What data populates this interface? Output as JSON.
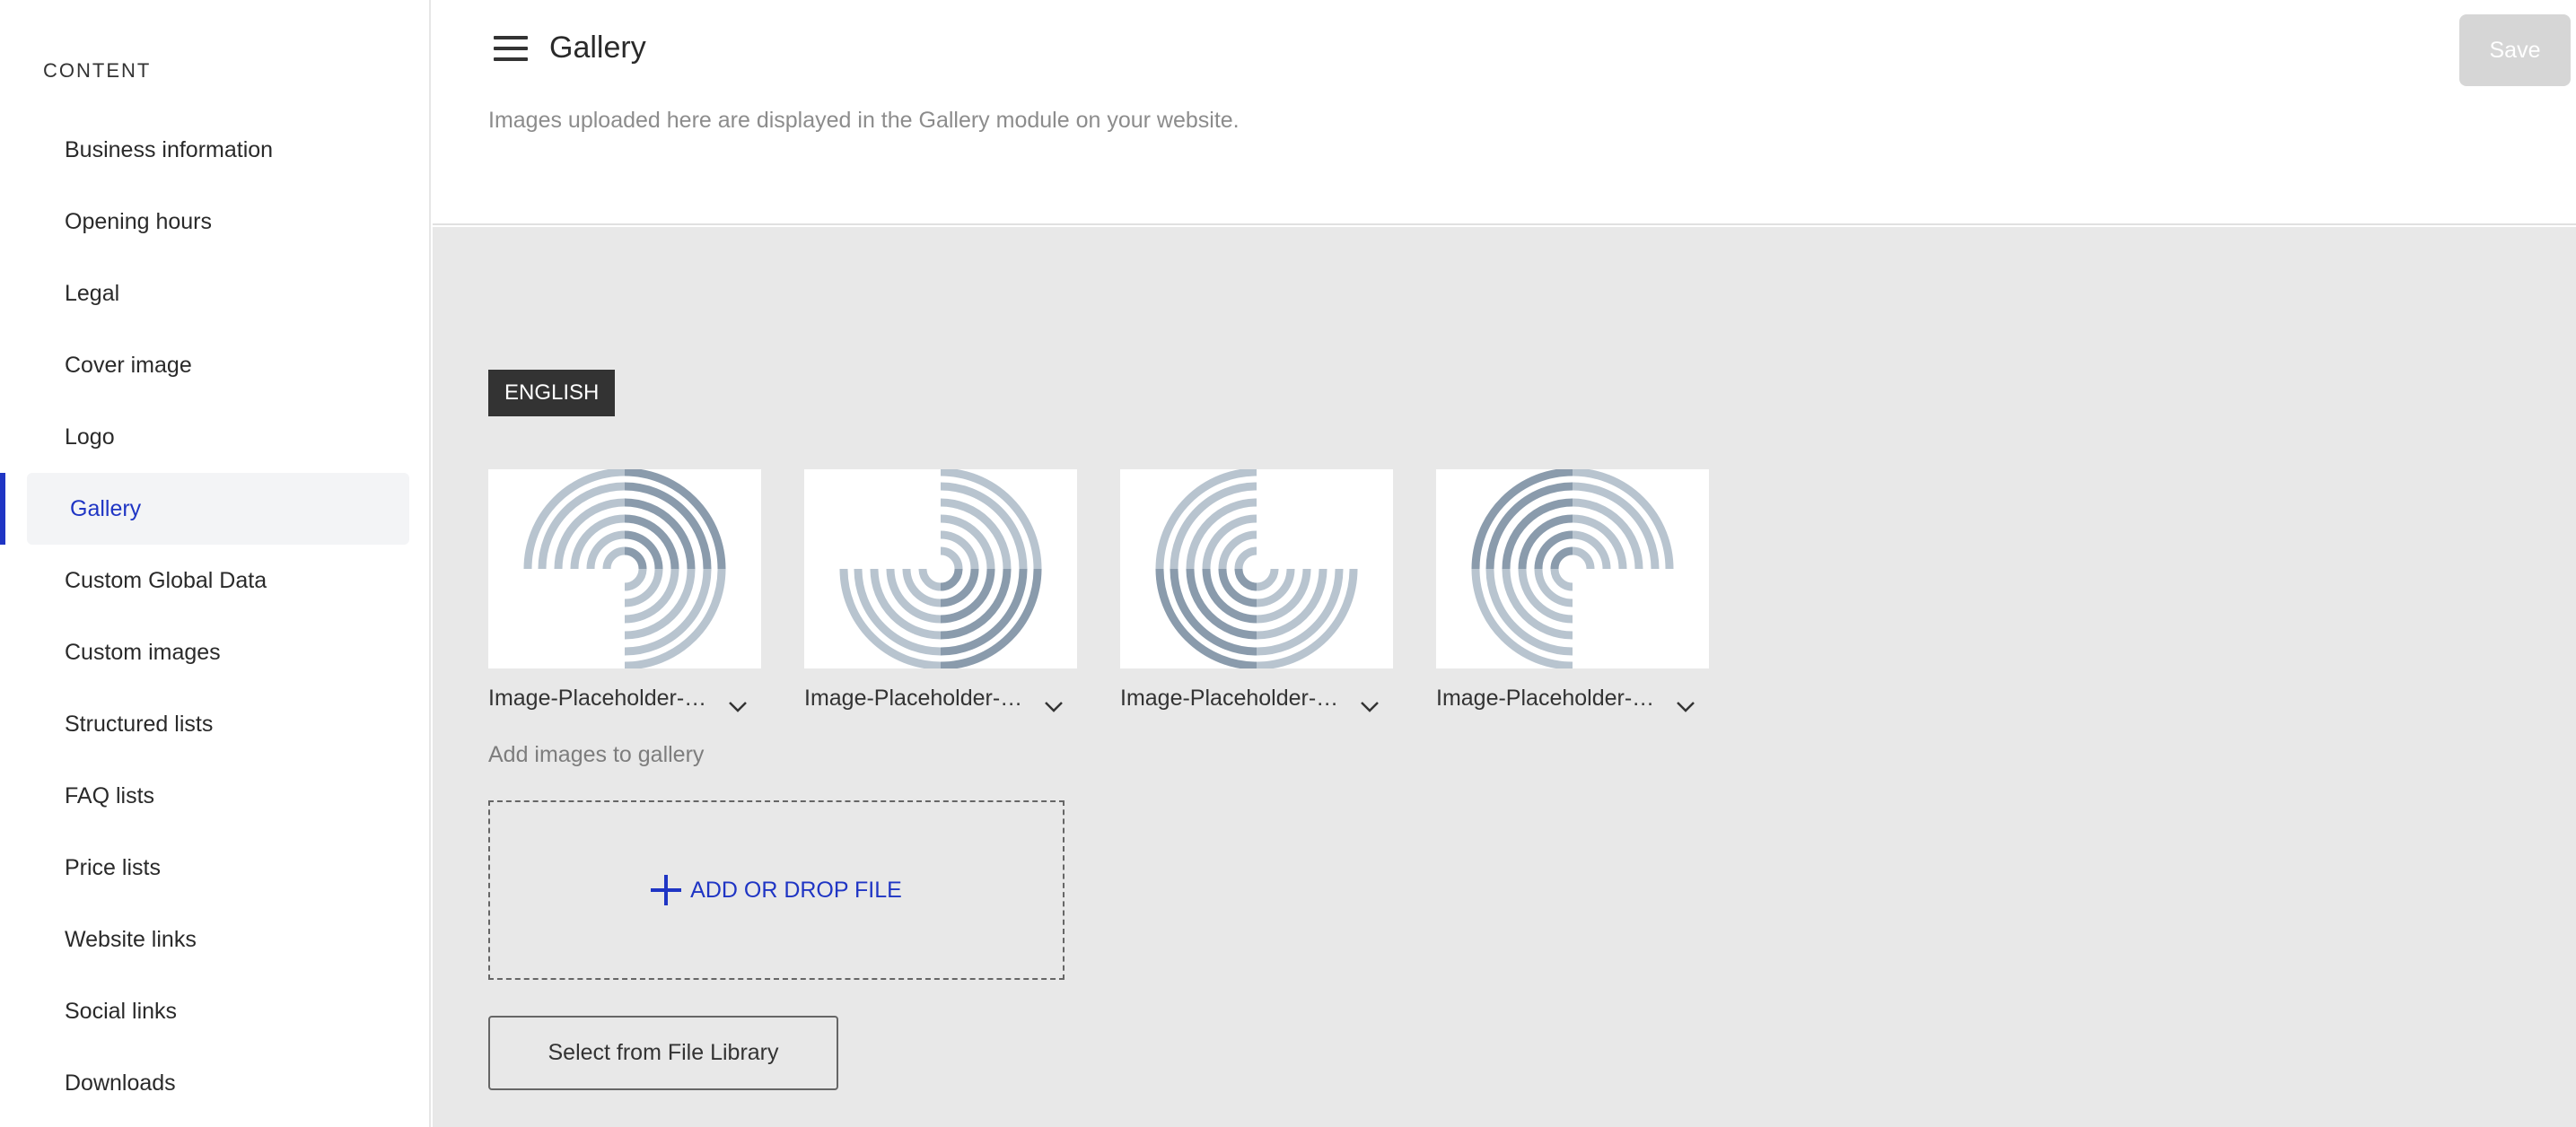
{
  "sidebar": {
    "heading": "CONTENT",
    "items": [
      {
        "label": "Business information"
      },
      {
        "label": "Opening hours"
      },
      {
        "label": "Legal"
      },
      {
        "label": "Cover image"
      },
      {
        "label": "Logo"
      },
      {
        "label": "Gallery",
        "active": true
      },
      {
        "label": "Custom Global Data"
      },
      {
        "label": "Custom images"
      },
      {
        "label": "Structured lists"
      },
      {
        "label": "FAQ lists"
      },
      {
        "label": "Price lists"
      },
      {
        "label": "Website links"
      },
      {
        "label": "Social links"
      },
      {
        "label": "Downloads"
      }
    ]
  },
  "header": {
    "menu_icon": "hamburger-menu-icon",
    "title": "Gallery",
    "description": "Images uploaded here are displayed in the Gallery module on your website.",
    "save_label": "Save"
  },
  "main": {
    "language_badge": "ENGLISH",
    "images": [
      {
        "name": "Image-Placeholder-C…",
        "variant": 1
      },
      {
        "name": "Image-Placeholder-C…",
        "variant": 2
      },
      {
        "name": "Image-Placeholder-C…",
        "variant": 3
      },
      {
        "name": "Image-Placeholder-C…",
        "variant": 4
      }
    ],
    "add_images_label": "Add images to gallery",
    "dropzone_label": "ADD OR DROP FILE",
    "library_button_label": "Select from File Library"
  },
  "colors": {
    "accent": "#1f35c4",
    "placeholder_dark": "#8a9bac",
    "placeholder_light": "#b8c4cf"
  }
}
